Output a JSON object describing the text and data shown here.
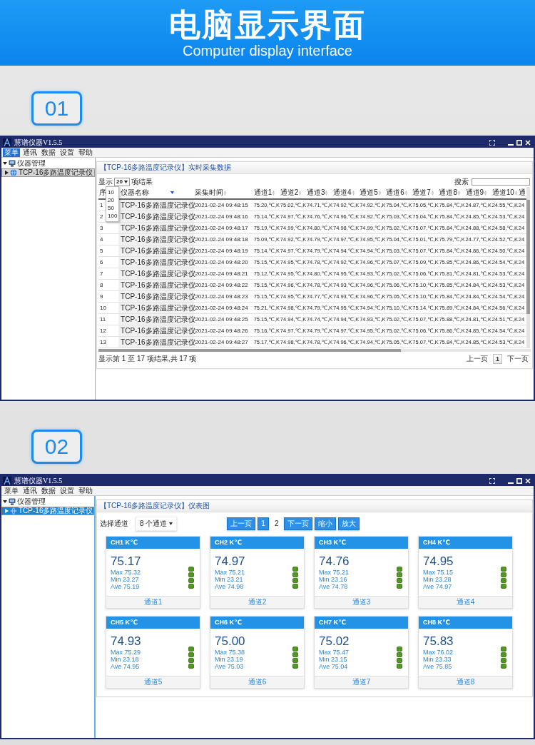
{
  "banner": {
    "title": "电脑显示界面",
    "subtitle": "Computer display interface"
  },
  "sections": [
    {
      "badge": "01",
      "kind": "table",
      "window": {
        "title": "慧谱仪器V1.5.5",
        "menu": [
          {
            "label": "菜单",
            "selected": true
          },
          {
            "label": "通讯",
            "selected": false
          },
          {
            "label": "数据",
            "selected": false
          },
          {
            "label": "设置",
            "selected": false
          },
          {
            "label": "帮助",
            "selected": false
          }
        ],
        "tree": {
          "label": "仪器管理",
          "expanded": true,
          "children": [
            {
              "label": "TCP-16多路温度记录仪",
              "selected": true
            }
          ]
        },
        "panel_title": "【TCP-16多路温度记录仪】实时采集数据",
        "length": {
          "label_before": "显示",
          "value": "20",
          "label_after": "项结果",
          "open": true,
          "options": [
            "10",
            "20",
            "50",
            "100"
          ]
        },
        "search": {
          "label": "搜索"
        },
        "columns": [
          {
            "label": "序",
            "kind": "plain"
          },
          {
            "label": "仪器名称",
            "kind": "sorted"
          },
          {
            "label": "采集时间",
            "kind": "sortable"
          },
          {
            "label": "通道1",
            "kind": "sortable"
          },
          {
            "label": "通道2",
            "kind": "sortable"
          },
          {
            "label": "通道3",
            "kind": "sortable"
          },
          {
            "label": "通道4",
            "kind": "sortable"
          },
          {
            "label": "通道5",
            "kind": "sortable"
          },
          {
            "label": "通道6",
            "kind": "sortable"
          },
          {
            "label": "通道7",
            "kind": "sortable"
          },
          {
            "label": "通道8",
            "kind": "sortable"
          },
          {
            "label": "通道9",
            "kind": "sortable"
          },
          {
            "label": "通道10",
            "kind": "sortable"
          },
          {
            "label": "通",
            "kind": "plain"
          }
        ],
        "rows": [
          [
            "1",
            "TCP-16多路温度记录仪",
            "2021-02-24 09:48:15",
            "75.20,℃,K",
            "75.02,℃,K",
            "74.71,℃,K",
            "74.92,℃,K",
            "74.92,℃,K",
            "75.04,℃,K",
            "75.05,℃,K",
            "75.84,℃,K",
            "24.87,℃,K",
            "24.55,℃,K",
            "24"
          ],
          [
            "2",
            "TCP-16多路温度记录仪",
            "2021-02-24 09:48:16",
            "75.14,℃,K",
            "74.97,℃,K",
            "74.76,℃,K",
            "74.96,℃,K",
            "74.92,℃,K",
            "75.03,℃,K",
            "75.04,℃,K",
            "75.84,℃,K",
            "24.85,℃,K",
            "24.53,℃,K",
            "24"
          ],
          [
            "3",
            "TCP-16多路温度记录仪",
            "2021-02-24 09:48:17",
            "75.19,℃,K",
            "74.99,℃,K",
            "74.80,℃,K",
            "74.98,℃,K",
            "74.99,℃,K",
            "75.02,℃,K",
            "75.07,℃,K",
            "75.84,℃,K",
            "24.88,℃,K",
            "24.58,℃,K",
            "24"
          ],
          [
            "4",
            "TCP-16多路温度记录仪",
            "2021-02-24 09:48:18",
            "75.09,℃,K",
            "74.92,℃,K",
            "74.79,℃,K",
            "74.97,℃,K",
            "74.95,℃,K",
            "75.04,℃,K",
            "75.01,℃,K",
            "75.79,℃,K",
            "24.77,℃,K",
            "24.52,℃,K",
            "24"
          ],
          [
            "5",
            "TCP-16多路温度记录仪",
            "2021-02-24 09:48:19",
            "75.14,℃,K",
            "74.97,℃,K",
            "74.79,℃,K",
            "74.94,℃,K",
            "74.94,℃,K",
            "75.03,℃,K",
            "75.07,℃,K",
            "75.84,℃,K",
            "24.86,℃,K",
            "24.50,℃,K",
            "24"
          ],
          [
            "6",
            "TCP-16多路温度记录仪",
            "2021-02-24 09:48:20",
            "75.15,℃,K",
            "74.95,℃,K",
            "74.78,℃,K",
            "74.92,℃,K",
            "74.96,℃,K",
            "75.07,℃,K",
            "75.09,℃,K",
            "75.85,℃,K",
            "24.86,℃,K",
            "24.54,℃,K",
            "24"
          ],
          [
            "7",
            "TCP-16多路温度记录仪",
            "2021-02-24 09:48:21",
            "75.12,℃,K",
            "74.95,℃,K",
            "74.80,℃,K",
            "74.95,℃,K",
            "74.93,℃,K",
            "75.02,℃,K",
            "75.06,℃,K",
            "75.81,℃,K",
            "24.81,℃,K",
            "24.53,℃,K",
            "24"
          ],
          [
            "8",
            "TCP-16多路温度记录仪",
            "2021-02-24 09:48:22",
            "75.15,℃,K",
            "74.96,℃,K",
            "74.78,℃,K",
            "74.93,℃,K",
            "74.96,℃,K",
            "75.06,℃,K",
            "75.10,℃,K",
            "75.85,℃,K",
            "24.84,℃,K",
            "24.53,℃,K",
            "24"
          ],
          [
            "9",
            "TCP-16多路温度记录仪",
            "2021-02-24 09:48:23",
            "75.15,℃,K",
            "74.95,℃,K",
            "74.77,℃,K",
            "74.93,℃,K",
            "74.96,℃,K",
            "75.05,℃,K",
            "75.10,℃,K",
            "75.84,℃,K",
            "24.84,℃,K",
            "24.54,℃,K",
            "24"
          ],
          [
            "10",
            "TCP-16多路温度记录仪",
            "2021-02-24 09:48:24",
            "75.21,℃,K",
            "74.98,℃,K",
            "74.79,℃,K",
            "74.95,℃,K",
            "74.94,℃,K",
            "75.10,℃,K",
            "75.14,℃,K",
            "75.89,℃,K",
            "24.84,℃,K",
            "24.56,℃,K",
            "24"
          ],
          [
            "11",
            "TCP-16多路温度记录仪",
            "2021-02-24 09:48:25",
            "75.15,℃,K",
            "74.94,℃,K",
            "74.74,℃,K",
            "74.94,℃,K",
            "74.93,℃,K",
            "75.02,℃,K",
            "75.07,℃,K",
            "75.88,℃,K",
            "24.81,℃,K",
            "24.51,℃,K",
            "24"
          ],
          [
            "12",
            "TCP-16多路温度记录仪",
            "2021-02-24 09:48:26",
            "75.16,℃,K",
            "74.97,℃,K",
            "74.79,℃,K",
            "74.97,℃,K",
            "74.95,℃,K",
            "75.02,℃,K",
            "75.06,℃,K",
            "75.86,℃,K",
            "24.85,℃,K",
            "24.54,℃,K",
            "24"
          ],
          [
            "13",
            "TCP-16多路温度记录仪",
            "2021-02-24 09:48:27",
            "75.17,℃,K",
            "74.98,℃,K",
            "74.78,℃,K",
            "74.96,℃,K",
            "74.94,℃,K",
            "75.05,℃,K",
            "75.07,℃,K",
            "75.84,℃,K",
            "24.85,℃,K",
            "24.53,℃,K",
            "24"
          ]
        ],
        "info": "显示第 1 至 17 项结果,共 17 项",
        "pager": [
          {
            "label": "上一页",
            "selected": false
          },
          {
            "label": "1",
            "selected": true
          },
          {
            "label": "下一页",
            "selected": false
          }
        ]
      }
    },
    {
      "badge": "02",
      "kind": "gauges",
      "window": {
        "title": "慧谱仪器V1.5.5",
        "menu": [
          {
            "label": "菜单",
            "selected": false
          },
          {
            "label": "通讯",
            "selected": false
          },
          {
            "label": "数据",
            "selected": false
          },
          {
            "label": "设置",
            "selected": false
          },
          {
            "label": "帮助",
            "selected": false
          }
        ],
        "tree": {
          "label": "仪器管理",
          "expanded": true,
          "children": [
            {
              "label": "TCP-16多路温度记录仪",
              "selected": true
            }
          ]
        },
        "panel_title": "【TCP-16多路温度记录仪】仪表图",
        "channel_select": {
          "label": "选择通道",
          "value": "8 个通道"
        },
        "pager": [
          {
            "label": "上一页",
            "selected": false
          },
          {
            "label": "1",
            "selected": false
          },
          {
            "label": "2",
            "selected": true
          },
          {
            "label": "下一页",
            "selected": false
          },
          {
            "label": "缩小",
            "selected": false
          },
          {
            "label": "放大",
            "selected": false
          }
        ],
        "cards": [
          {
            "title": "CH1 K℃",
            "value": "75.17",
            "stats": [
              "Max 75.32",
              "Min 23.27",
              "Ave 75.19"
            ],
            "footer": "通道1"
          },
          {
            "title": "CH2 K℃",
            "value": "74.97",
            "stats": [
              "Max 75.21",
              "Min 23.21",
              "Ave 74.98"
            ],
            "footer": "通道2"
          },
          {
            "title": "CH3 K℃",
            "value": "74.76",
            "stats": [
              "Max 75.21",
              "Min 23.16",
              "Ave 74.78"
            ],
            "footer": "通道3"
          },
          {
            "title": "CH4 K℃",
            "value": "74.95",
            "stats": [
              "Max 75.15",
              "Min 23.28",
              "Ave 74.97"
            ],
            "footer": "通道4"
          },
          {
            "title": "CH5 K℃",
            "value": "74.93",
            "stats": [
              "Max 75.29",
              "Min 23.18",
              "Ave 74.95"
            ],
            "footer": "通道5"
          },
          {
            "title": "CH6 K℃",
            "value": "75.00",
            "stats": [
              "Max 75.38",
              "Min 23.19",
              "Ave 75.03"
            ],
            "footer": "通道6"
          },
          {
            "title": "CH7 K℃",
            "value": "75.02",
            "stats": [
              "Max 75.47",
              "Min 23.15",
              "Ave 75.04"
            ],
            "footer": "通道7"
          },
          {
            "title": "CH8 K℃",
            "value": "75.83",
            "stats": [
              "Max 76.02",
              "Min 23.33",
              "Ave 75.85"
            ],
            "footer": "通道8"
          }
        ]
      }
    }
  ]
}
